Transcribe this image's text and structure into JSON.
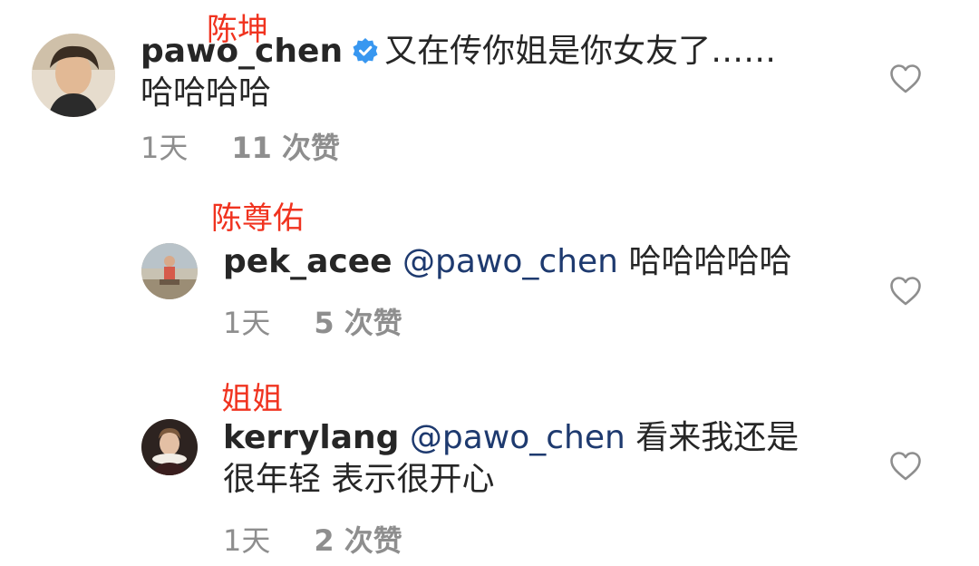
{
  "comments": [
    {
      "annotation": "陈坤",
      "username": "pawo_chen",
      "verified": true,
      "text_line1": "又在传你姐是你女友了……",
      "text_line2": "哈哈哈哈",
      "time": "1天",
      "likes": "11 次赞"
    },
    {
      "annotation": "陈尊佑",
      "username": "pek_acee",
      "mention": "@pawo_chen",
      "text": "哈哈哈哈哈",
      "time": "1天",
      "likes": "5 次赞"
    },
    {
      "annotation": "姐姐",
      "username": "kerrylang",
      "mention": "@pawo_chen",
      "text_line1": "看来我还是",
      "text_line2": "很年轻 表示很开心",
      "time": "1天",
      "likes": "2 次赞"
    }
  ],
  "colors": {
    "annotation": "#f0331f",
    "mention": "#1e3a6f",
    "verified": "#3897f0",
    "meta": "#8e8e8e"
  },
  "icons": [
    "verified-badge-icon",
    "heart-outline-icon"
  ]
}
